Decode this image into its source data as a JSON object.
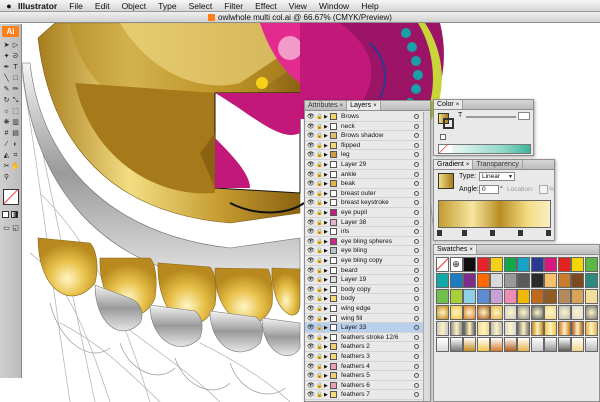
{
  "menubar": {
    "apple": "",
    "app_name": "Illustrator",
    "items": [
      "File",
      "Edit",
      "Object",
      "Type",
      "Select",
      "Filter",
      "Effect",
      "View",
      "Window",
      "Help"
    ]
  },
  "document": {
    "title": "owlwhole multi col.ai @ 66.67% (CMYK/Preview)"
  },
  "toolbar": {
    "logo": "Ai"
  },
  "layers_panel": {
    "tabs": [
      {
        "label": "Attributes",
        "x": "×"
      },
      {
        "label": "Layers",
        "x": "×"
      }
    ],
    "rows": [
      "Brows",
      "neck",
      "Brows shadow",
      "flipped",
      "leg",
      "Layer 29",
      "ankle",
      "beak",
      "breast outer",
      "breast keystroke",
      "eye pupil",
      "Layer 38",
      "iris",
      "eye bling spheres",
      "eye bling",
      "eye bling copy",
      "beard",
      "Layer 19",
      "body copy",
      "body",
      "wing edge",
      "wing fill",
      "Layer 33",
      "feathers stroke 12/6",
      "feathers 2",
      "feathers 3",
      "feathers 4",
      "feathers 5",
      "feathers 6",
      "feathers 7"
    ],
    "selected_index": 22,
    "thumb_colors": [
      "#f3d46a",
      "#ffffff",
      "#dcc070",
      "#f6d47a",
      "#d29a3e",
      "#ffffff",
      "#ffffff",
      "#e2b54a",
      "#ffffff",
      "#ffffff",
      "#c2207c",
      "#e6b6ce",
      "#ffffff",
      "#c82a86",
      "#b8c4c8",
      "#ffffff",
      "#ffffff",
      "#e2e2e2",
      "#ffffff",
      "#f3d87e",
      "#ffffff",
      "#ffffff",
      "#ffffff",
      "#ffffff",
      "#f0d272",
      "#f3d87e",
      "#e9a0b8",
      "#f0d272",
      "#e9a0b8",
      "#f3d87e"
    ]
  },
  "color_panel": {
    "tabs": [
      {
        "label": "Color",
        "x": "×"
      }
    ],
    "slider_label": "T"
  },
  "gradient_panel": {
    "tabs": [
      {
        "label": "Gradient",
        "x": "×"
      },
      {
        "label": "Transparency",
        "x": ""
      }
    ],
    "type_label": "Type:",
    "type_value": "Linear",
    "angle_label": "Angle:",
    "angle_value": "0",
    "angle_unit": "°",
    "location_label": "Location:",
    "location_unit": "%"
  },
  "swatches_panel": {
    "tabs": [
      {
        "label": "Swatches",
        "x": "×"
      }
    ],
    "colors": [
      "#ffffff",
      "#ffffff",
      "#0e0e0e",
      "#e3242b",
      "#f7d117",
      "#13a64b",
      "#17a3c5",
      "#2b3990",
      "#d7197d",
      "#e42320",
      "#f4d600",
      "#5bb644",
      "#12a8a5",
      "#1b7cc2",
      "#7b2d8b",
      "#ff6a00",
      "#d9d9d9",
      "#9a9a9a",
      "#5a5a5a",
      "#2a2a2a",
      "#f7c26b",
      "#c97b2e",
      "#7b4a1e",
      "#2d8a7f",
      "#6fbf4a",
      "#a6cf3a",
      "#8fcfe8",
      "#5d8bd4",
      "#c7a2d6",
      "#f08cb3",
      "#f2b705",
      "#c06a1d",
      "#8f5b20",
      "#b38a5b",
      "#d9a45a",
      "#f3dd9a",
      "#d8b44a",
      "#b48922",
      "#9d7a2a",
      "#e8c560",
      "#cfa84a",
      "#b99a3a",
      "#f6e0a0"
    ],
    "row3_gradients": [
      "#c28b1a",
      "#f2c64a",
      "#d47c2a",
      "#b25c1f",
      "#e6b24a",
      "#c9c9c9",
      "#909090",
      "#5e5e5e",
      "#f0d78a",
      "#b8b8b8",
      "#d8d8d8",
      "#777777"
    ]
  },
  "colors": {
    "gold": "#c59b2f",
    "gold_light": "#f3dd83",
    "magenta": "#c2187a",
    "teal": "#189fa8",
    "orange_ai": "#ff7f18",
    "selection": "#b8d0ee"
  }
}
